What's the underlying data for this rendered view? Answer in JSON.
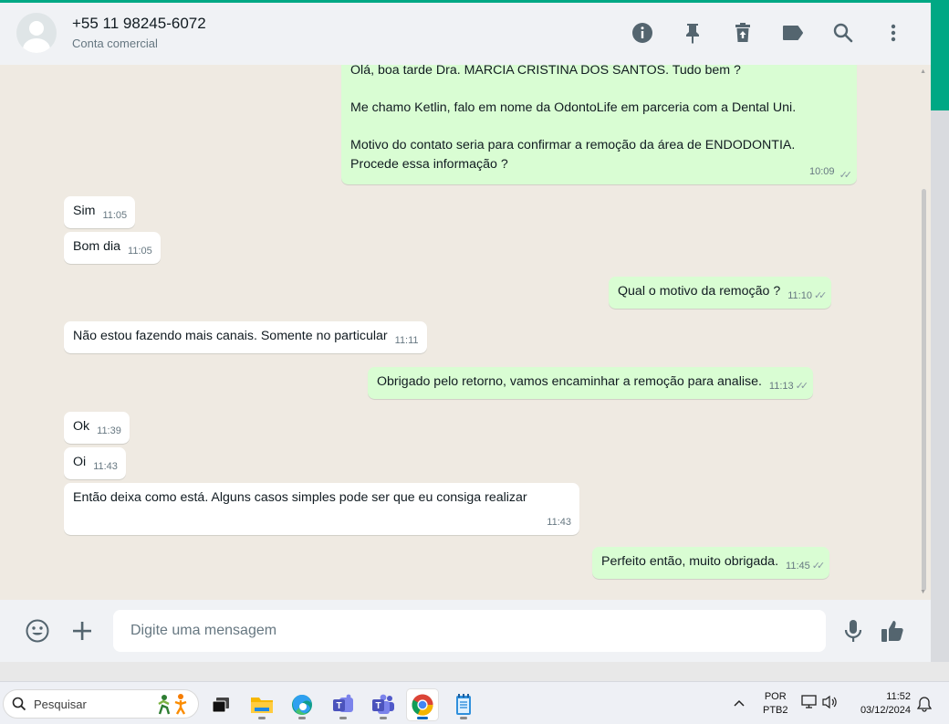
{
  "header": {
    "contact_name": "+55 11 98245-6072",
    "contact_subtitle": "Conta comercial"
  },
  "messages": [
    {
      "dir": "out",
      "lines": [
        "Olá, boa tarde Dra.  MARCIA CRISTINA DOS SANTOS. Tudo bem ?",
        "",
        "Me chamo Ketlin, falo em nome da OdontoLife em parceria com a Dental Uni.",
        "",
        "Motivo do contato seria para confirmar a remoção da área de ENDODONTIA.",
        "Procede essa informação ?"
      ],
      "time": "10:09"
    },
    {
      "dir": "in",
      "text": "Sim",
      "time": "11:05"
    },
    {
      "dir": "in",
      "text": "Bom dia",
      "time": "11:05"
    },
    {
      "dir": "out",
      "text": "Qual o motivo da remoção ?",
      "time": "11:10"
    },
    {
      "dir": "in",
      "text": "Não estou fazendo mais  canais. Somente no particular",
      "time": "11:11"
    },
    {
      "dir": "out",
      "text": "Obrigado pelo retorno, vamos encaminhar a remoção para analise.",
      "time": "11:13"
    },
    {
      "dir": "in",
      "text": "Ok",
      "time": "11:39"
    },
    {
      "dir": "in",
      "text": "Oi",
      "time": "11:43"
    },
    {
      "dir": "in",
      "text": "Então deixa como está. Alguns casos simples pode ser que eu consiga realizar",
      "time": "11:43"
    },
    {
      "dir": "out",
      "text": "Perfeito então, muito obrigada.",
      "time": "11:45"
    }
  ],
  "composer": {
    "placeholder": "Digite uma mensagem"
  },
  "taskbar": {
    "search_label": "Pesquisar",
    "lang_line1": "POR",
    "lang_line2": "PTB2",
    "time": "11:52",
    "date": "03/12/2024"
  },
  "colors": {
    "accent": "#00a884",
    "outgoing_bubble": "#d9fdd3",
    "incoming_bubble": "#ffffff",
    "chat_bg": "#efeae2",
    "icon_gray": "#54656f"
  }
}
